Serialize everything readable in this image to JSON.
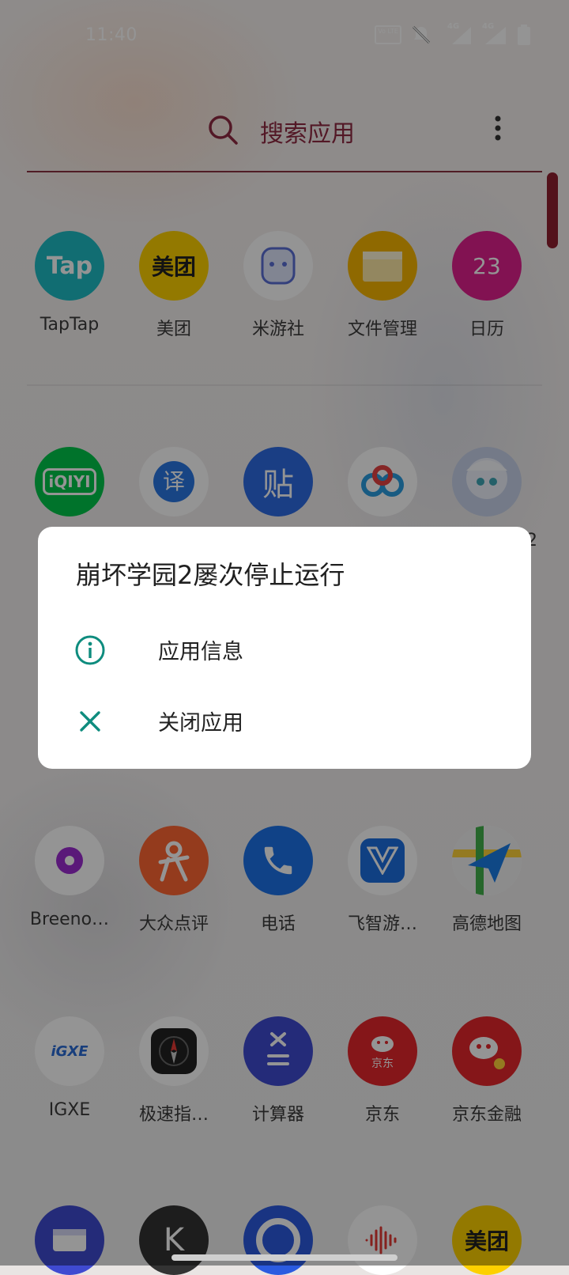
{
  "status_bar": {
    "time": "11:40",
    "icons": [
      "volte-icon",
      "mute-bell-icon",
      "signal-4g-icon",
      "signal-4g-icon",
      "battery-icon"
    ],
    "volte_text": "Vo LTE",
    "sim1_label": "4G",
    "sim2_label": "4G"
  },
  "search": {
    "placeholder": "搜索应用"
  },
  "apps": {
    "row1": [
      {
        "label": "TapTap",
        "icon_text": "Tap",
        "color": "#1ebcc4"
      },
      {
        "label": "美团",
        "icon_text": "美团",
        "color": "#fdd000"
      },
      {
        "label": "米游社",
        "icon_text": "",
        "color": "#ffffff"
      },
      {
        "label": "文件管理",
        "icon_text": "",
        "color": "#f7b500"
      },
      {
        "label": "日历",
        "icon_text": "23",
        "color": "#e0208e"
      }
    ],
    "row2": [
      {
        "label": "",
        "icon_text": "iQIYI",
        "color": "#00c64a"
      },
      {
        "label": "",
        "icon_text": "译",
        "color": "#ffffff"
      },
      {
        "label": "",
        "icon_text": "贴",
        "color": "#2d6ce3"
      },
      {
        "label": "",
        "icon_text": "",
        "color": "#ffffff"
      },
      {
        "label": "2",
        "icon_text": "",
        "color": "#c9d3ea"
      }
    ],
    "row3": [
      {
        "label": "Breeno…",
        "icon_text": "",
        "color": "#ffffff"
      },
      {
        "label": "大众点评",
        "icon_text": "",
        "color": "#ff6633"
      },
      {
        "label": "电话",
        "icon_text": "",
        "color": "#1c73e8"
      },
      {
        "label": "飞智游…",
        "icon_text": "",
        "color": "#ffffff"
      },
      {
        "label": "高德地图",
        "icon_text": "",
        "color": "#ffffff"
      }
    ],
    "row4": [
      {
        "label": "IGXE",
        "icon_text": "iGXE",
        "color": "#ffffff"
      },
      {
        "label": "极速指…",
        "icon_text": "",
        "color": "#ffffff"
      },
      {
        "label": "计算器",
        "icon_text": "",
        "color": "#3f4ad1"
      },
      {
        "label": "京东",
        "icon_text": "京东",
        "color": "#e6262b"
      },
      {
        "label": "京东金融",
        "icon_text": "",
        "color": "#e6262b"
      }
    ],
    "row5": [
      {
        "label": "",
        "icon_text": "",
        "color": "#3f4ad1"
      },
      {
        "label": "",
        "icon_text": "K",
        "color": "#333333"
      },
      {
        "label": "",
        "icon_text": "",
        "color": "#2b5be0"
      },
      {
        "label": "",
        "icon_text": "",
        "color": "#ffffff"
      },
      {
        "label": "",
        "icon_text": "美团",
        "color": "#fdd000"
      }
    ]
  },
  "dialog": {
    "title": "崩坏学园2屡次停止运行",
    "items": [
      {
        "label": "应用信息",
        "icon": "info-icon"
      },
      {
        "label": "关闭应用",
        "icon": "close-icon"
      }
    ],
    "accent": "#0e8c7e"
  }
}
